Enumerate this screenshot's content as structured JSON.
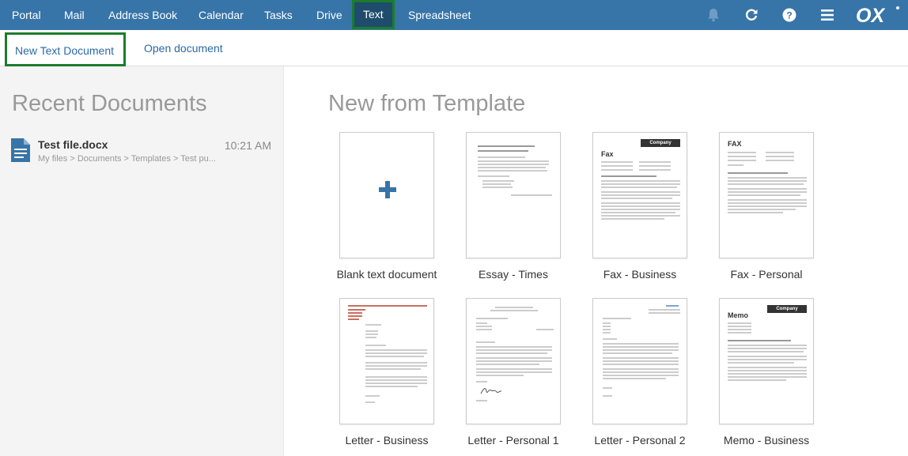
{
  "nav": {
    "items": [
      "Portal",
      "Mail",
      "Address Book",
      "Calendar",
      "Tasks",
      "Drive",
      "Text",
      "Spreadsheet"
    ],
    "active": "Text",
    "icons": [
      "bell-icon",
      "refresh-icon",
      "help-icon",
      "menu-icon"
    ],
    "logo": "OX"
  },
  "toolbar": {
    "new_doc_label": "New Text Document",
    "open_doc_label": "Open document"
  },
  "recent": {
    "title": "Recent Documents",
    "items": [
      {
        "name": "Test file.docx",
        "time": "10:21 AM",
        "path": "My files > Documents > Templates > Test pu..."
      }
    ]
  },
  "templates": {
    "title": "New from Template",
    "items": [
      {
        "label": "Blank text document"
      },
      {
        "label": "Essay - Times"
      },
      {
        "label": "Fax - Business"
      },
      {
        "label": "Fax - Personal"
      },
      {
        "label": "Letter - Business"
      },
      {
        "label": "Letter - Personal 1"
      },
      {
        "label": "Letter - Personal 2"
      },
      {
        "label": "Memo - Business"
      }
    ],
    "thumb_text": {
      "company": "Company",
      "fax": "Fax",
      "fax_upper": "FAX",
      "memo": "Memo"
    }
  },
  "colors": {
    "topbar": "#3774a8",
    "active_tab": "#1f4c6c",
    "highlight_outline": "#1c7c2c",
    "link": "#2a6aa6"
  }
}
